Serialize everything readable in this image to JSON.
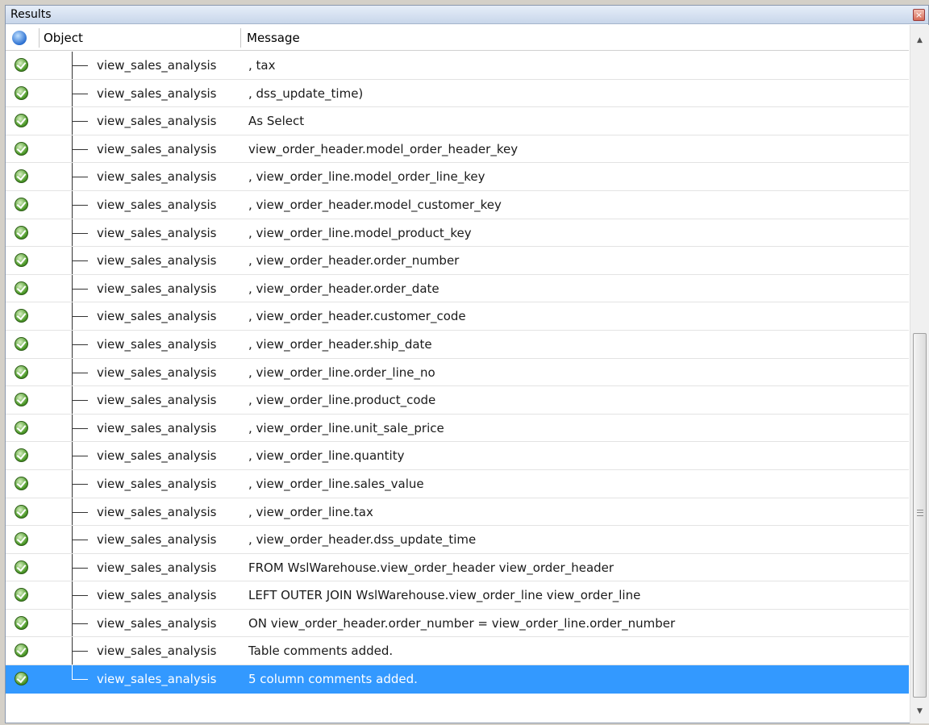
{
  "panel": {
    "title": "Results",
    "close_glyph": "×"
  },
  "columns": {
    "icon": "info-icon",
    "object": "Object",
    "message": "Message"
  },
  "rows": [
    {
      "object": "view_sales_analysis",
      "message": ", tax",
      "status": "success"
    },
    {
      "object": "view_sales_analysis",
      "message": ", dss_update_time)",
      "status": "success"
    },
    {
      "object": "view_sales_analysis",
      "message": "As Select",
      "status": "success"
    },
    {
      "object": "view_sales_analysis",
      "message": "view_order_header.model_order_header_key",
      "status": "success"
    },
    {
      "object": "view_sales_analysis",
      "message": ", view_order_line.model_order_line_key",
      "status": "success"
    },
    {
      "object": "view_sales_analysis",
      "message": ", view_order_header.model_customer_key",
      "status": "success"
    },
    {
      "object": "view_sales_analysis",
      "message": ", view_order_line.model_product_key",
      "status": "success"
    },
    {
      "object": "view_sales_analysis",
      "message": ", view_order_header.order_number",
      "status": "success"
    },
    {
      "object": "view_sales_analysis",
      "message": ", view_order_header.order_date",
      "status": "success"
    },
    {
      "object": "view_sales_analysis",
      "message": ", view_order_header.customer_code",
      "status": "success"
    },
    {
      "object": "view_sales_analysis",
      "message": ", view_order_header.ship_date",
      "status": "success"
    },
    {
      "object": "view_sales_analysis",
      "message": ", view_order_line.order_line_no",
      "status": "success"
    },
    {
      "object": "view_sales_analysis",
      "message": ", view_order_line.product_code",
      "status": "success"
    },
    {
      "object": "view_sales_analysis",
      "message": ", view_order_line.unit_sale_price",
      "status": "success"
    },
    {
      "object": "view_sales_analysis",
      "message": ", view_order_line.quantity",
      "status": "success"
    },
    {
      "object": "view_sales_analysis",
      "message": ", view_order_line.sales_value",
      "status": "success"
    },
    {
      "object": "view_sales_analysis",
      "message": ", view_order_line.tax",
      "status": "success"
    },
    {
      "object": "view_sales_analysis",
      "message": ", view_order_header.dss_update_time",
      "status": "success"
    },
    {
      "object": "view_sales_analysis",
      "message": "FROM WslWarehouse.view_order_header view_order_header",
      "status": "success"
    },
    {
      "object": "view_sales_analysis",
      "message": "LEFT OUTER JOIN WslWarehouse.view_order_line view_order_line",
      "status": "success"
    },
    {
      "object": "view_sales_analysis",
      "message": "ON view_order_header.order_number = view_order_line.order_number",
      "status": "success"
    },
    {
      "object": "view_sales_analysis",
      "message": "Table comments added.",
      "status": "success"
    },
    {
      "object": "view_sales_analysis",
      "message": "5 column comments added.",
      "status": "success",
      "selected": true
    }
  ],
  "scrollbar": {
    "up_glyph": "▲",
    "down_glyph": "▼",
    "position_fraction": 0.55
  },
  "colors": {
    "selection": "#3399ff",
    "success": "#4e9a2a"
  }
}
